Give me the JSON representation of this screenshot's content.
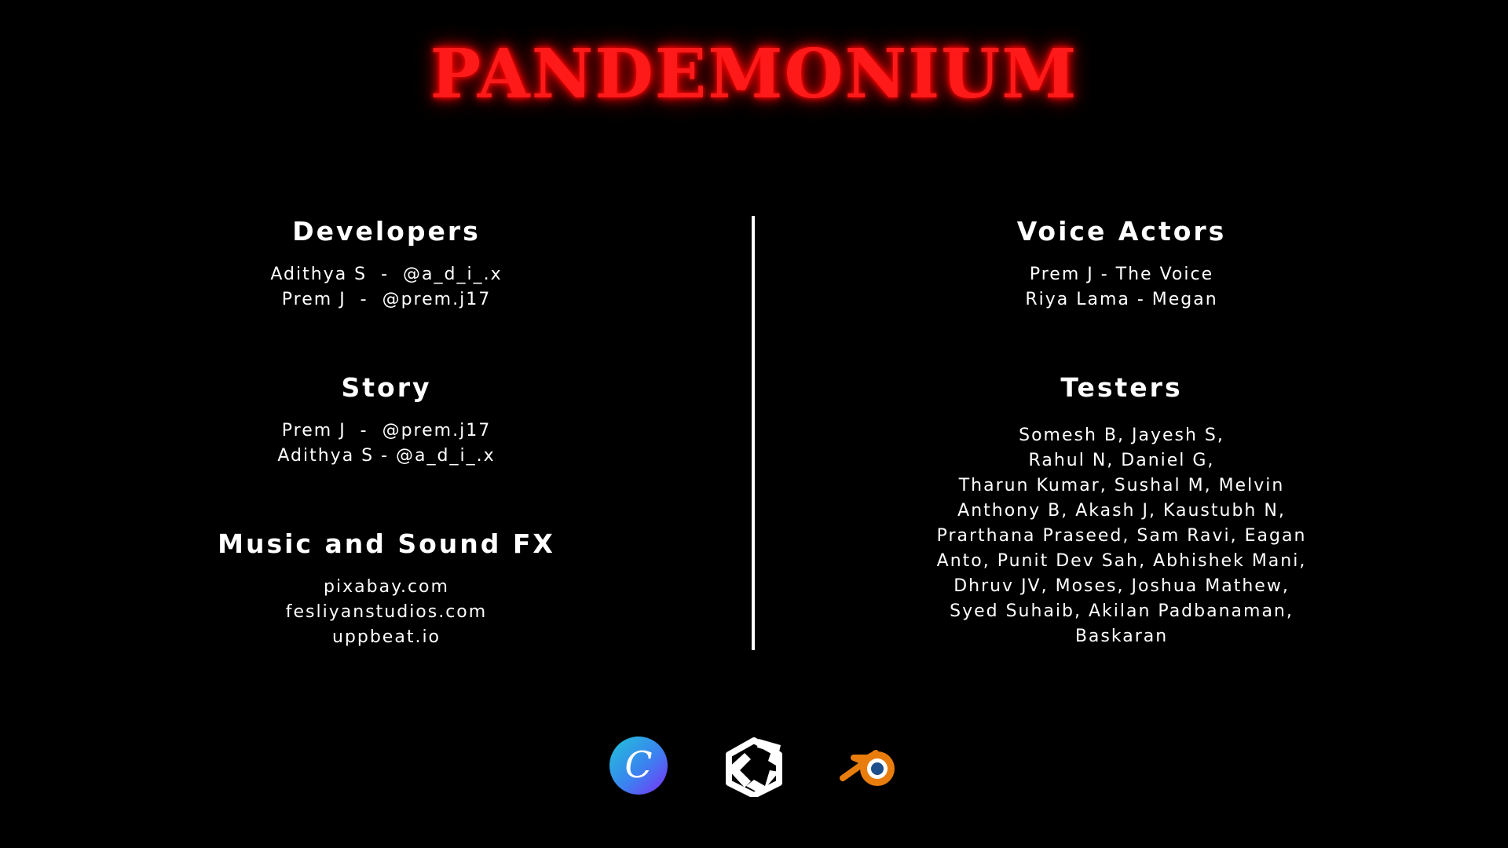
{
  "title": "PANDEMONIUM",
  "credits": {
    "developers": {
      "heading": "Developers",
      "lines": [
        "Adithya S  -  @a_d_i_.x",
        "Prem J  -  @prem.j17"
      ]
    },
    "story": {
      "heading": "Story",
      "lines": [
        "Prem J  -  @prem.j17",
        "Adithya S - @a_d_i_.x"
      ]
    },
    "music": {
      "heading": "Music and Sound FX",
      "lines": [
        "pixabay.com",
        "fesliyanstudios.com",
        "uppbeat.io"
      ]
    },
    "voice_actors": {
      "heading": "Voice Actors",
      "lines": [
        "Prem J - The Voice",
        "Riya Lama - Megan"
      ]
    },
    "testers": {
      "heading": "Testers",
      "lines": [
        "Somesh B, Jayesh S,",
        "Rahul N, Daniel G,",
        "Tharun Kumar, Sushal M, Melvin",
        "Anthony B, Akash J, Kaustubh N,",
        "Prarthana Praseed, Sam Ravi, Eagan",
        "Anto, Punit Dev Sah, Abhishek Mani,",
        "Dhruv JV, Moses, Joshua Mathew,",
        "Syed Suhaib, Akilan Padbanaman,",
        "Baskaran"
      ]
    }
  },
  "tools": {
    "canva": {
      "icon": "canva-logo-icon",
      "letter": "C"
    },
    "unity": {
      "icon": "unity-logo-icon"
    },
    "blender": {
      "icon": "blender-logo-icon",
      "color": "#e87d0d"
    }
  },
  "colors": {
    "background": "#000000",
    "title": "#ff1a1a",
    "text": "#ffffff"
  }
}
